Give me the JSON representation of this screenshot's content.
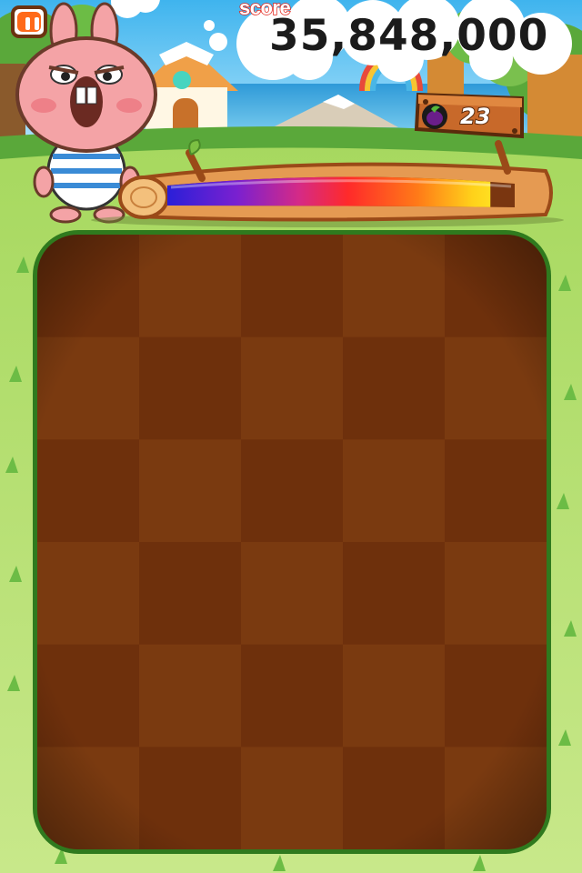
{
  "game": {
    "score_label": "score",
    "score_value": "35,848,000",
    "item_count": "23",
    "time_remaining_fraction": 0.93
  },
  "icons": {
    "pause": "pause-icon",
    "item": "eggplant-icon"
  },
  "board": {
    "rows": 6,
    "cols": 5
  },
  "colors": {
    "accent_orange": "#ff6a1a",
    "score_outline_red": "#e2231a",
    "board_dark": "#6e300c",
    "board_light": "#7a3a10"
  }
}
